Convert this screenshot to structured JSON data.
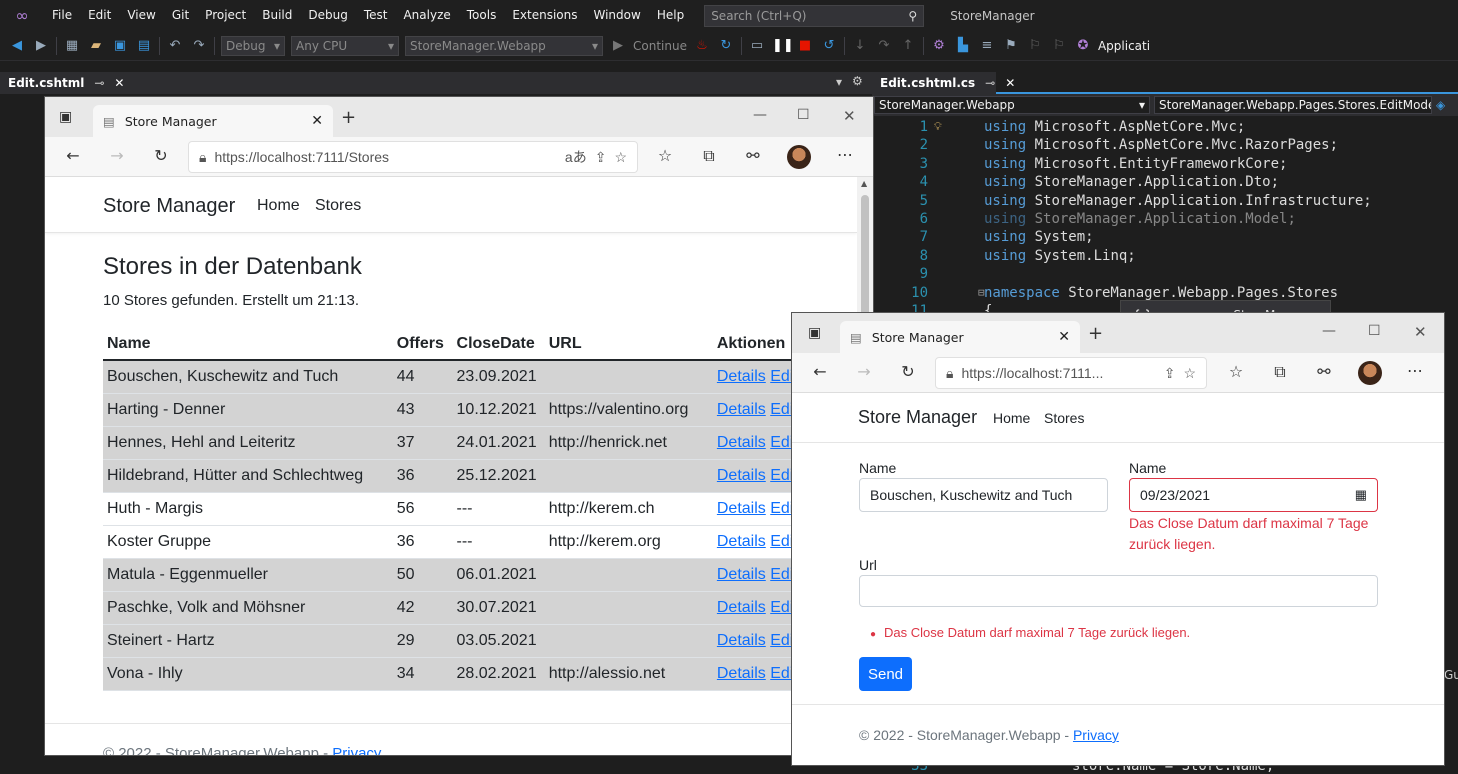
{
  "vs": {
    "menu": [
      "File",
      "Edit",
      "View",
      "Git",
      "Project",
      "Build",
      "Debug",
      "Test",
      "Analyze",
      "Tools",
      "Extensions",
      "Window",
      "Help"
    ],
    "search_placeholder": "Search (Ctrl+Q)",
    "title": "StoreManager",
    "toolbar": {
      "config": "Debug",
      "platform": "Any CPU",
      "startup_project": "StoreManager.Webapp",
      "continue_label": "Continue",
      "overflow_label": "Applicati"
    },
    "left_tab": "Edit.cshtml",
    "right_tab": "Edit.cshtml.cs",
    "nav_project": "StoreManager.Webapp",
    "nav_class": "StoreManager.Webapp.Pages.Stores.EditModel",
    "code_lines": [
      {
        "n": "1",
        "kw": "using",
        "rest": " Microsoft.AspNetCore.Mvc;"
      },
      {
        "n": "2",
        "kw": "using",
        "rest": " Microsoft.AspNetCore.Mvc.RazorPages;"
      },
      {
        "n": "3",
        "kw": "using",
        "rest": " Microsoft.EntityFrameworkCore;"
      },
      {
        "n": "4",
        "kw": "using",
        "rest": " StoreManager.Application.Dto;"
      },
      {
        "n": "5",
        "kw": "using",
        "rest": " StoreManager.Application.Infrastructure;"
      },
      {
        "n": "6",
        "kw": "using",
        "rest": " StoreManager.Application.Model;"
      },
      {
        "n": "7",
        "kw": "using",
        "rest": " System;"
      },
      {
        "n": "8",
        "kw": "using",
        "rest": " System.Linq;"
      },
      {
        "n": "9",
        "kw": "",
        "rest": ""
      },
      {
        "n": "10",
        "kw": "namespace",
        "rest": " StoreManager.Webapp.Pages.Stores"
      },
      {
        "n": "11",
        "kw": "",
        "rest": "{"
      }
    ],
    "bottom_line": {
      "n": "33",
      "text": "store.Name = Store.Name;"
    },
    "tooltip": {
      "kw": "namespace",
      "name": "StoreManager"
    },
    "side_text": "Gu"
  },
  "browser1": {
    "tab_title": "Store Manager",
    "url": "https://localhost:7111/Stores",
    "brand": "Store Manager",
    "nav": [
      "Home",
      "Stores"
    ],
    "heading": "Stores in der Datenbank",
    "subtitle": "10 Stores gefunden. Erstellt um 21:13.",
    "columns": [
      "Name",
      "Offers",
      "CloseDate",
      "URL",
      "Aktionen"
    ],
    "details_label": "Details",
    "edit_label": "Edit",
    "rows": [
      {
        "name": "Bouschen, Kuschewitz and Tuch",
        "offers": "44",
        "close": "23.09.2021",
        "url": "",
        "shaded": true
      },
      {
        "name": "Harting - Denner",
        "offers": "43",
        "close": "10.12.2021",
        "url": "https://valentino.org",
        "shaded": true
      },
      {
        "name": "Hennes, Hehl and Leiteritz",
        "offers": "37",
        "close": "24.01.2021",
        "url": "http://henrick.net",
        "shaded": true
      },
      {
        "name": "Hildebrand, Hütter and Schlechtweg",
        "offers": "36",
        "close": "25.12.2021",
        "url": "",
        "shaded": true
      },
      {
        "name": "Huth - Margis",
        "offers": "56",
        "close": "---",
        "url": "http://kerem.ch",
        "shaded": false
      },
      {
        "name": "Koster Gruppe",
        "offers": "36",
        "close": "---",
        "url": "http://kerem.org",
        "shaded": false
      },
      {
        "name": "Matula - Eggenmueller",
        "offers": "50",
        "close": "06.01.2021",
        "url": "",
        "shaded": true
      },
      {
        "name": "Paschke, Volk and Möhsner",
        "offers": "42",
        "close": "30.07.2021",
        "url": "",
        "shaded": true
      },
      {
        "name": "Steinert - Hartz",
        "offers": "29",
        "close": "03.05.2021",
        "url": "",
        "shaded": true
      },
      {
        "name": "Vona - Ihly",
        "offers": "34",
        "close": "28.02.2021",
        "url": "http://alessio.net",
        "shaded": true
      }
    ],
    "footer": "© 2022 - StoreManager.Webapp -",
    "footer_link": "Privacy"
  },
  "browser2": {
    "tab_title": "Store Manager",
    "url": "https://localhost:7111...",
    "brand": "Store Manager",
    "nav": [
      "Home",
      "Stores"
    ],
    "name_label": "Name",
    "name_value": "Bouschen, Kuschewitz and Tuch",
    "date_label": "Name",
    "date_value": "09/23/2021",
    "date_error": "Das Close Datum darf maximal 7 Tage zurück liegen.",
    "url_label": "Url",
    "url_value": "",
    "summary_error": "Das Close Datum darf maximal 7 Tage zurück liegen.",
    "send_label": "Send",
    "footer": "© 2022 - StoreManager.Webapp -",
    "footer_link": "Privacy"
  },
  "colors": {
    "vs_bg": "#1e1e1e",
    "accent": "#3a96dd",
    "link": "#0d6efd",
    "error": "#dc3545",
    "row_shade": "#d3d3d3"
  }
}
